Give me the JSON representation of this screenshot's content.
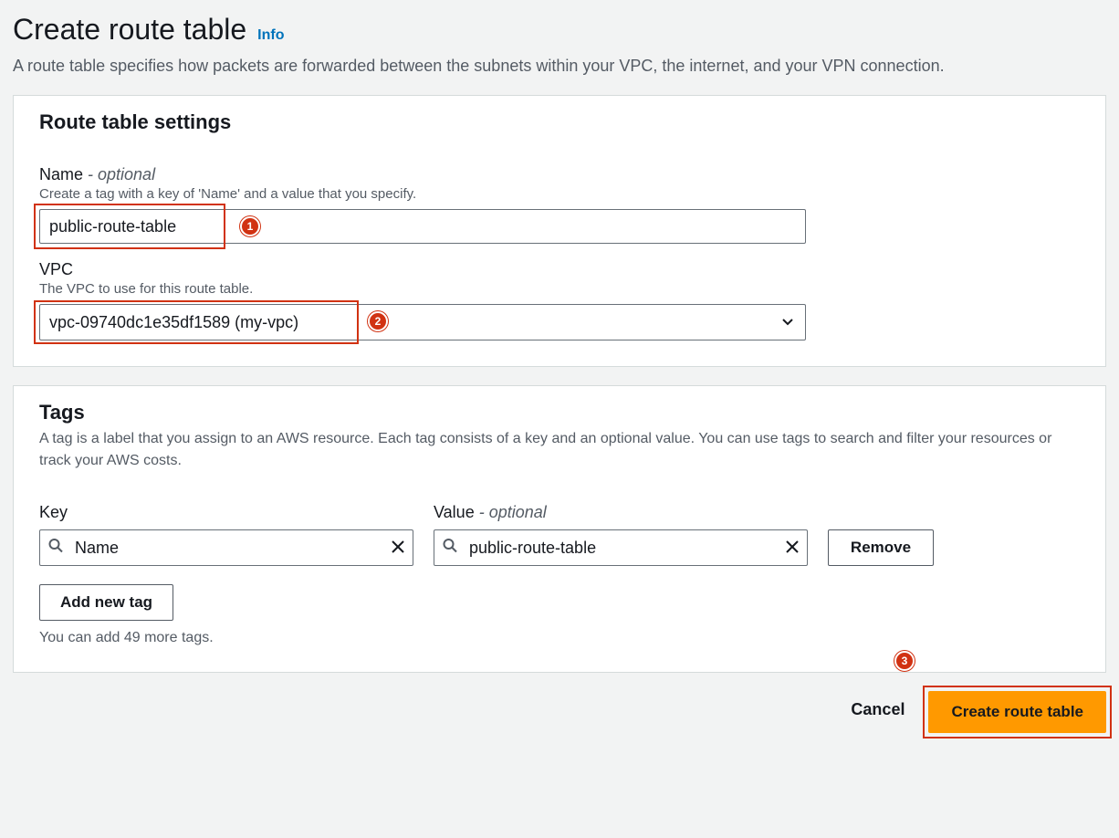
{
  "header": {
    "title": "Create route table",
    "info_label": "Info",
    "description": "A route table specifies how packets are forwarded between the subnets within your VPC, the internet, and your VPN connection."
  },
  "settings": {
    "panel_title": "Route table settings",
    "name_field": {
      "label": "Name",
      "optional_suffix": " - optional",
      "help": "Create a tag with a key of 'Name' and a value that you specify.",
      "value": "public-route-table"
    },
    "vpc_field": {
      "label": "VPC",
      "help": "The VPC to use for this route table.",
      "selected": "vpc-09740dc1e35df1589 (my-vpc)"
    }
  },
  "tags": {
    "panel_title": "Tags",
    "panel_description": "A tag is a label that you assign to an AWS resource. Each tag consists of a key and an optional value. You can use tags to search and filter your resources or track your AWS costs.",
    "key_label": "Key",
    "value_label": "Value",
    "value_optional_suffix": " - optional",
    "rows": [
      {
        "key": "Name",
        "value": "public-route-table"
      }
    ],
    "remove_label": "Remove",
    "add_label": "Add new tag",
    "limit_text": "You can add 49 more tags."
  },
  "footer": {
    "cancel_label": "Cancel",
    "submit_label": "Create route table"
  },
  "callouts": {
    "c1": "1",
    "c2": "2",
    "c3": "3"
  }
}
